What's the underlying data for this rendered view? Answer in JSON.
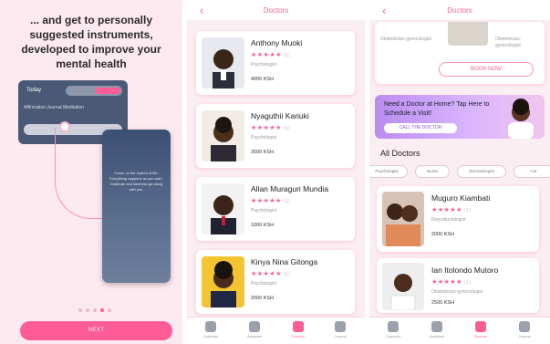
{
  "onboarding": {
    "title": "... and get to personally suggested instruments, developed to improve your mental health",
    "mock_today": "Today",
    "mock_tabs": "Affirmation   Journal   Meditation",
    "mock_phone_text": "Focus on the rhythm of life. Everything happens as you wish. Gratitude and kindness go along with you.",
    "next_label": "NEXT",
    "pager_count": 5,
    "pager_active": 4
  },
  "doctors_screen": {
    "title": "Doctors",
    "back": "‹",
    "doctors": [
      {
        "name": "Anthony Muoki",
        "stars": "★★★★★",
        "count": "(1)",
        "specialty": "Psychologist",
        "price": "4000 KSH"
      },
      {
        "name": "Nyaguthii Kariuki",
        "stars": "★★★★★",
        "count": "(1)",
        "specialty": "Psychologist",
        "price": "3000 KSH"
      },
      {
        "name": "Allan Muraguri Mundia",
        "stars": "★★★★★",
        "count": "(1)",
        "specialty": "Psychologist",
        "price": "1000 KSH"
      },
      {
        "name": "Kinya Nina Gitonga",
        "stars": "★★★★★",
        "count": "(1)",
        "specialty": "Psychologist",
        "price": "2000 KSH"
      }
    ]
  },
  "all_doctors_screen": {
    "title": "Doctors",
    "back": "‹",
    "top_spec_left": "Obstetrician gynecologist",
    "top_spec_right": "Obstetrician-gynecologist",
    "book_label": "BOOK NOW",
    "banner_text": "Need a Doctor at Home? Tap Here to Schedule a Visit!",
    "banner_btn": "CALL THE DOCTOR",
    "all_title": "All Doctors",
    "chips": [
      "Psychologist",
      "Nurse",
      "Dermatologist",
      "Car"
    ],
    "doctors": [
      {
        "name": "Muguro Kiambati",
        "stars": "★★★★★",
        "count": "(1)",
        "specialty": "Reproductologist",
        "price": "2000 KSH"
      },
      {
        "name": "Ian Itolondo Mutoro",
        "stars": "★★★★★",
        "count": "(1)",
        "specialty": "Obstetrician-gynecologist",
        "price": "2500 KSH"
      }
    ]
  },
  "nav": {
    "items": [
      {
        "label": "Calendar",
        "icon": "calendar-icon"
      },
      {
        "label": "Assistant",
        "icon": "heart-icon"
      },
      {
        "label": "Doctors",
        "icon": "medical-cross-icon"
      },
      {
        "label": "Journal",
        "icon": "journal-icon"
      }
    ],
    "active_index": 2
  },
  "colors": {
    "accent": "#ff5c97",
    "banner": "#c79af5",
    "mock_dark": "#4a5a76"
  }
}
